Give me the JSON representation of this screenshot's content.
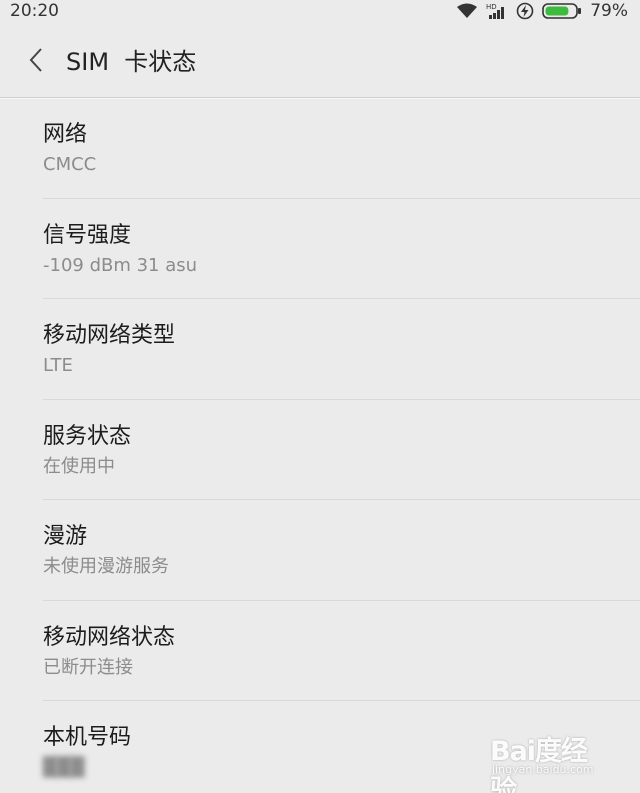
{
  "status_bar": {
    "time": "20:20",
    "battery_percent": "79%",
    "battery_level": 0.79,
    "network_badge": "HD",
    "icons": [
      "wifi-icon",
      "signal-icon",
      "charging-icon",
      "battery-icon"
    ]
  },
  "header": {
    "back_icon": "chevron-left-icon",
    "title": "SIM  卡状态"
  },
  "items": [
    {
      "label": "网络",
      "value": "CMCC"
    },
    {
      "label": "信号强度",
      "value": "-109 dBm 31 asu"
    },
    {
      "label": "移动网络类型",
      "value": "LTE"
    },
    {
      "label": "服务状态",
      "value": "在使用中"
    },
    {
      "label": "漫游",
      "value": "未使用漫游服务"
    },
    {
      "label": "移动网络状态",
      "value": "已断开连接"
    },
    {
      "label": "本机号码",
      "value": "███"
    }
  ],
  "watermark": {
    "brand": "Bai度经验",
    "url": "jingyan.baidu.com"
  },
  "colors": {
    "background": "#ebebeb",
    "battery_green": "#3dbb3d",
    "divider": "#d9d9d9"
  }
}
